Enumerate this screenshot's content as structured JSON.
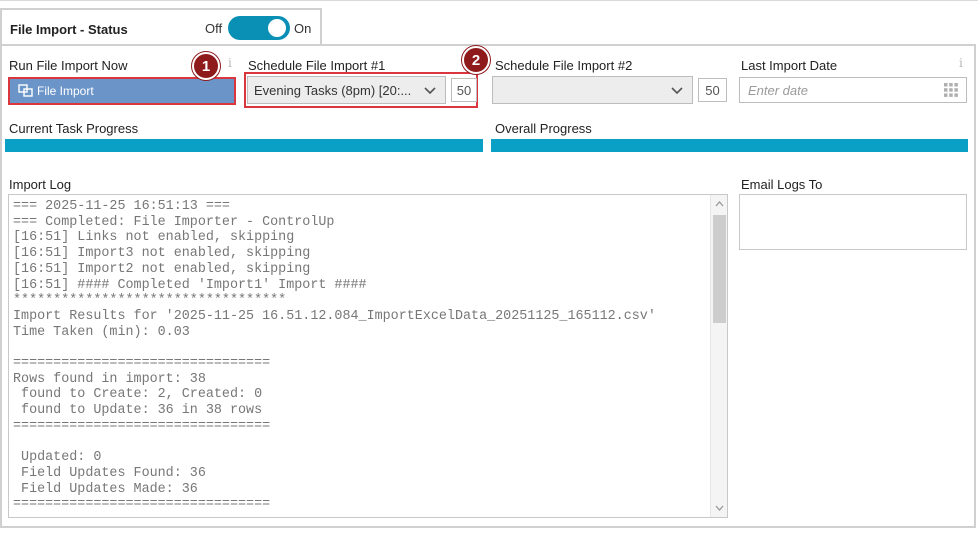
{
  "tab": {
    "title": "File Import - Status",
    "toggle_off_label": "Off",
    "toggle_on_label": "On",
    "toggle_state": "on"
  },
  "run_now": {
    "label": "Run File Import Now",
    "button_label": "File Import",
    "info": "i",
    "badge": "1"
  },
  "schedule1": {
    "label": "Schedule File Import #1",
    "selected": "Evening Tasks (8pm)  [20:...",
    "number": "50",
    "badge": "2"
  },
  "schedule2": {
    "label": "Schedule File Import #2",
    "selected": "",
    "number": "50"
  },
  "last_import": {
    "label": "Last Import Date",
    "placeholder": "Enter date",
    "info": "i"
  },
  "progress": {
    "current_label": "Current Task Progress",
    "current_value": 1.0,
    "overall_label": "Overall Progress",
    "overall_value": 1.0
  },
  "import_log": {
    "label": "Import Log",
    "lines": [
      "=== 2025-11-25 16:51:13 ===",
      "=== Completed: File Importer - ControlUp",
      "[16:51] Links not enabled, skipping",
      "[16:51] Import3 not enabled, skipping",
      "[16:51] Import2 not enabled, skipping",
      "[16:51] #### Completed 'Import1' Import ####",
      "**********************************",
      "Import Results for '2025-11-25 16.51.12.084_ImportExcelData_20251125_165112.csv'",
      "Time Taken (min): 0.03",
      "",
      "================================",
      "Rows found in import: 38",
      " found to Create: 2, Created: 0",
      " found to Update: 36 in 38 rows",
      "================================",
      "",
      " Updated: 0",
      " Field Updates Found: 36",
      " Field Updates Made: 36",
      "================================"
    ]
  },
  "email_logs": {
    "label": "Email Logs To",
    "value": ""
  },
  "colors": {
    "accent": "#0a8fb5",
    "progress": "#0aa0c5",
    "button": "#6b94c9",
    "highlight": "#d9363e",
    "badge": "#8e1a1c"
  }
}
